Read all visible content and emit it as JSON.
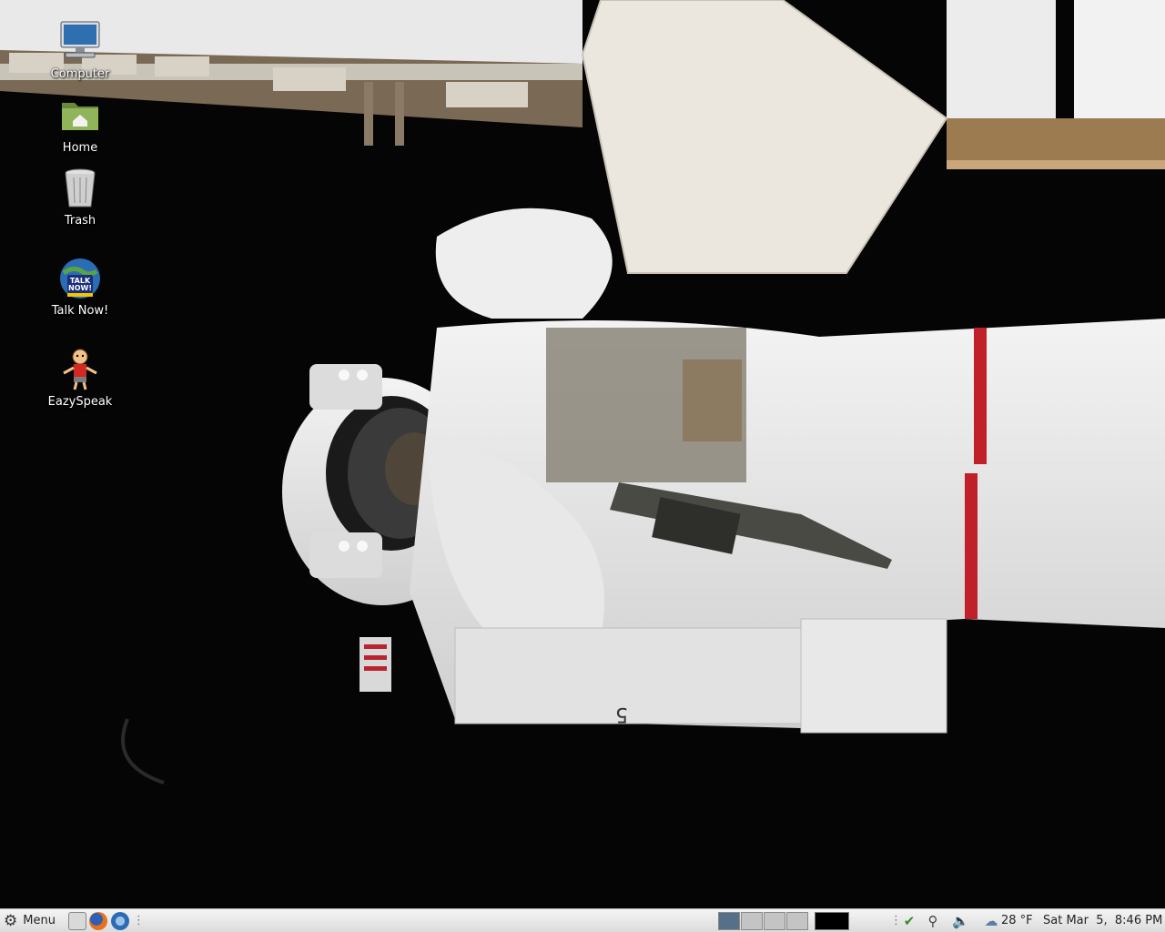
{
  "desktop": {
    "icons": [
      {
        "label": "Computer"
      },
      {
        "label": "Home"
      },
      {
        "label": "Trash"
      },
      {
        "label": "Talk Now!",
        "badge_line1": "TALK",
        "badge_line2": "NOW!"
      },
      {
        "label": "EazySpeak"
      }
    ],
    "wallpaper": {
      "suit_number": "5"
    }
  },
  "panel": {
    "menu_label": "Menu",
    "launchers": [
      "show-desktop-icon",
      "firefox-icon",
      "thunderbird-icon"
    ],
    "workspaces": [
      {
        "name": "workspace-1",
        "active": true
      },
      {
        "name": "workspace-2",
        "active": false
      },
      {
        "name": "workspace-3",
        "active": false
      },
      {
        "name": "workspace-4",
        "active": false
      }
    ],
    "tray": {
      "icons": [
        "shield-update-icon",
        "network-icon",
        "volume-icon",
        "weather-cloud-icon"
      ],
      "temperature": "28 °F",
      "clock": "Sat Mar  5,  8:46 PM"
    }
  },
  "colors": {
    "panel_bg": "#e6e6e6",
    "workspace_active": "#56708a",
    "desktop_bg": "#050505"
  }
}
